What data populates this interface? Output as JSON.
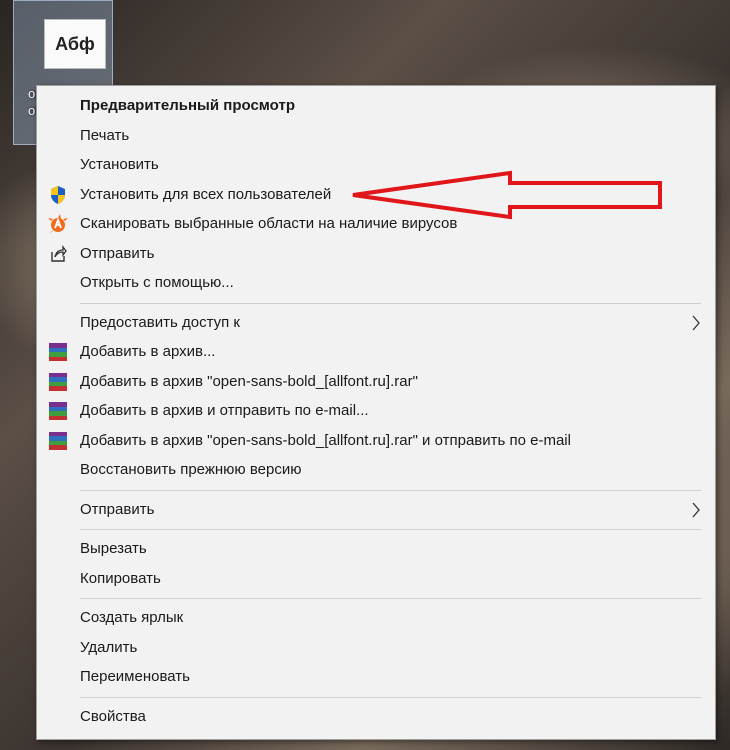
{
  "desktop": {
    "file_icon_text": "Абф",
    "file_label": "op\nol"
  },
  "menu": {
    "items": [
      {
        "label": "Предварительный просмотр"
      },
      {
        "label": "Печать"
      },
      {
        "label": "Установить"
      },
      {
        "label": "Установить для всех пользователей",
        "icon": "uac-shield-icon"
      },
      {
        "label": "Сканировать выбранные области на наличие вирусов",
        "icon": "avast-icon"
      },
      {
        "label": "Отправить",
        "icon": "share-icon"
      },
      {
        "label": "Открыть с помощью..."
      },
      {
        "label": "Предоставить доступ к",
        "submenu": true
      },
      {
        "label": "Добавить в архив...",
        "icon": "winrar-icon"
      },
      {
        "label": "Добавить в архив \"open-sans-bold_[allfont.ru].rar\"",
        "icon": "winrar-icon"
      },
      {
        "label": "Добавить в архив и отправить по e-mail...",
        "icon": "winrar-icon"
      },
      {
        "label": "Добавить в архив \"open-sans-bold_[allfont.ru].rar\" и отправить по e-mail",
        "icon": "winrar-icon"
      },
      {
        "label": "Восстановить прежнюю версию"
      },
      {
        "label": "Отправить",
        "submenu": true
      },
      {
        "label": "Вырезать"
      },
      {
        "label": "Копировать"
      },
      {
        "label": "Создать ярлык"
      },
      {
        "label": "Удалить"
      },
      {
        "label": "Переименовать"
      },
      {
        "label": "Свойства"
      }
    ]
  },
  "colors": {
    "menu_bg": "#f2f2f2",
    "annotation_arrow": "#e0161b",
    "avast_orange": "#f26b1d",
    "uac_blue": "#1f5fbf",
    "uac_yellow": "#f5c518"
  }
}
